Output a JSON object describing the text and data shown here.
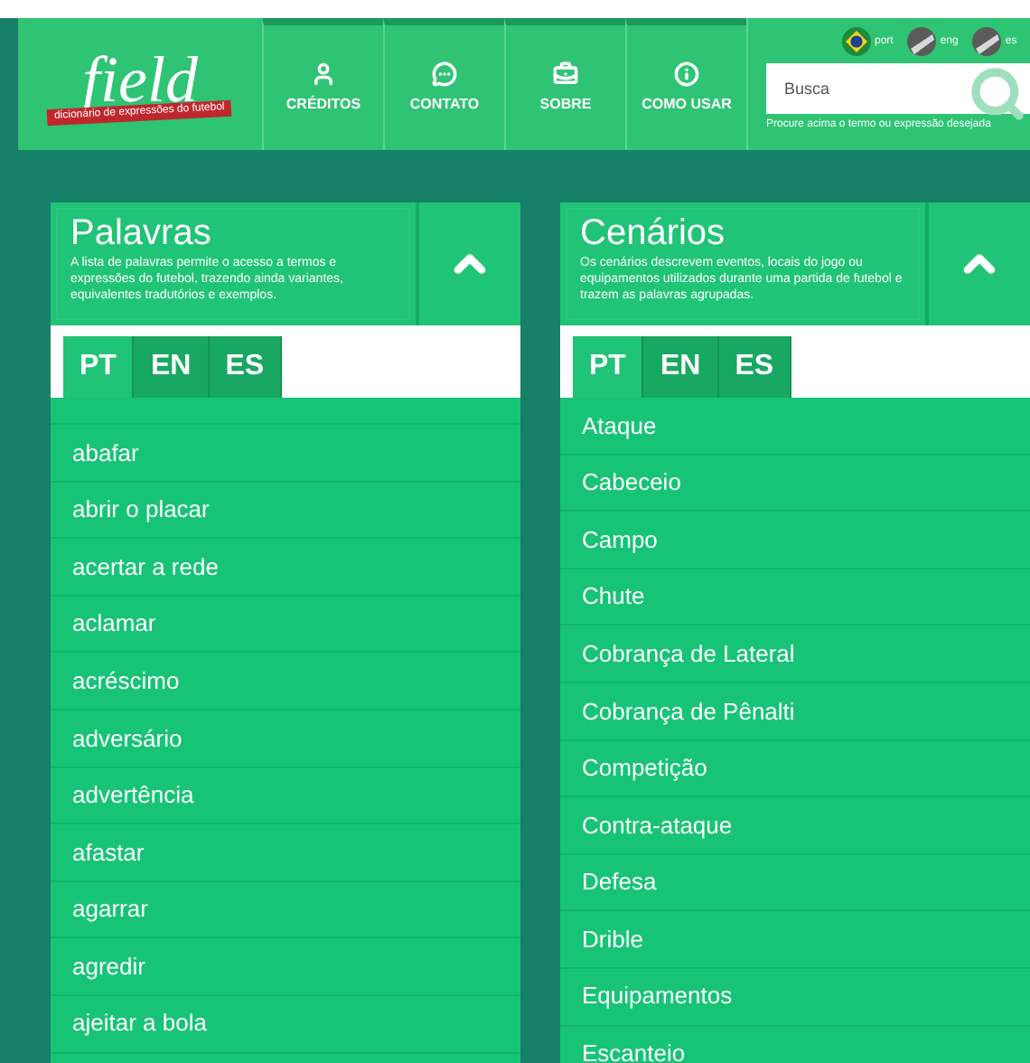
{
  "logo": {
    "title": "field",
    "ribbon": "dicionário de expressões do futebol"
  },
  "nav": [
    {
      "label": "CRÉDITOS",
      "kind": "person"
    },
    {
      "label": "CONTATO",
      "kind": "chat"
    },
    {
      "label": "SOBRE",
      "kind": "briefcase"
    },
    {
      "label": "COMO USAR",
      "kind": "info"
    }
  ],
  "languages": [
    {
      "label": "port",
      "kind": "brazil"
    },
    {
      "label": "eng",
      "kind": "gray"
    },
    {
      "label": "es",
      "kind": "gray"
    }
  ],
  "search": {
    "placeholder": "Busca",
    "caption": "Procure acima o termo ou expressão desejada"
  },
  "panels": [
    {
      "title": "Palavras",
      "description": "A lista de palavras permite o acesso a termos e expressões do futebol, trazendo ainda variantes, equivalentes tradutórios e exemplos.",
      "tabs": [
        {
          "label": "PT",
          "selected": true
        },
        {
          "label": "EN",
          "selected": false
        },
        {
          "label": "ES",
          "selected": false
        }
      ],
      "spacer": true,
      "items": [
        "abafar",
        "abrir o placar",
        "acertar a rede",
        "aclamar",
        "acréscimo",
        "adversário",
        "advertência",
        "afastar",
        "agarrar",
        "agredir",
        "ajeitar a bola"
      ]
    },
    {
      "title": "Cenários",
      "description": "Os cenários descrevem eventos, locais do jogo ou equipamentos utilizados durante uma partida de futebol e trazem as palavras agrupadas.",
      "tabs": [
        {
          "label": "PT",
          "selected": true
        },
        {
          "label": "EN",
          "selected": false
        },
        {
          "label": "ES",
          "selected": false
        }
      ],
      "spacer": false,
      "items": [
        "Ataque",
        "Cabeceio",
        "Campo",
        "Chute",
        "Cobrança de Lateral",
        "Cobrança de Pênalti",
        "Competição",
        "Contra-ataque",
        "Defesa",
        "Drible",
        "Equipamentos",
        "Escanteio"
      ]
    }
  ]
}
